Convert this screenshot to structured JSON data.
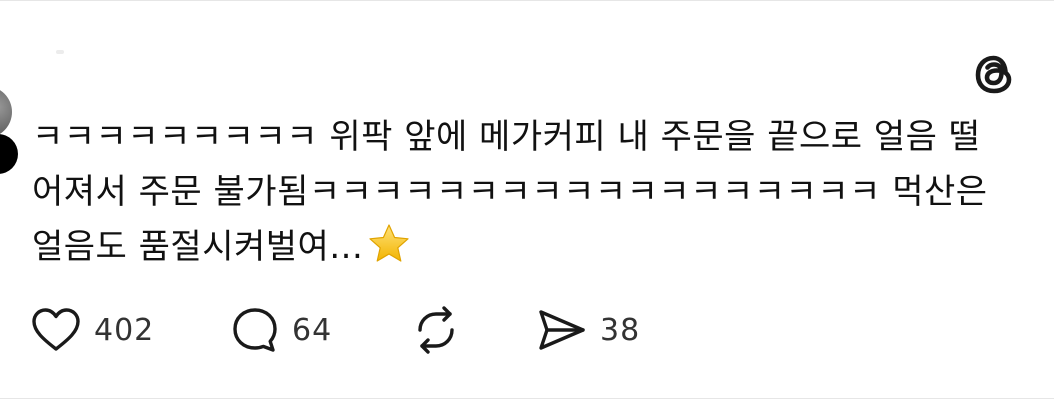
{
  "post": {
    "text_line1": "ㅋㅋㅋㅋㅋㅋㅋㅋㅋ 위팍 앞에 메가커피 내 주문을 끝으로 얼음 떨",
    "text_line2": "어져서 주문 불가됨ㅋㅋㅋㅋㅋㅋㅋㅋㅋㅋㅋㅋㅋㅋㅋㅋㅋㅋ 먹산은",
    "text_line3": "얼음도 품절시켜벌여...",
    "emoji": "star"
  },
  "actions": {
    "likes": "402",
    "replies": "64",
    "shares": "38"
  },
  "icons": {
    "brand": "threads-logo-icon",
    "like": "heart-icon",
    "reply": "speech-bubble-icon",
    "repost": "repost-icon",
    "share": "send-icon"
  },
  "colors": {
    "text": "#111111",
    "icon": "#1a1a1a",
    "star": "#f5c518"
  }
}
